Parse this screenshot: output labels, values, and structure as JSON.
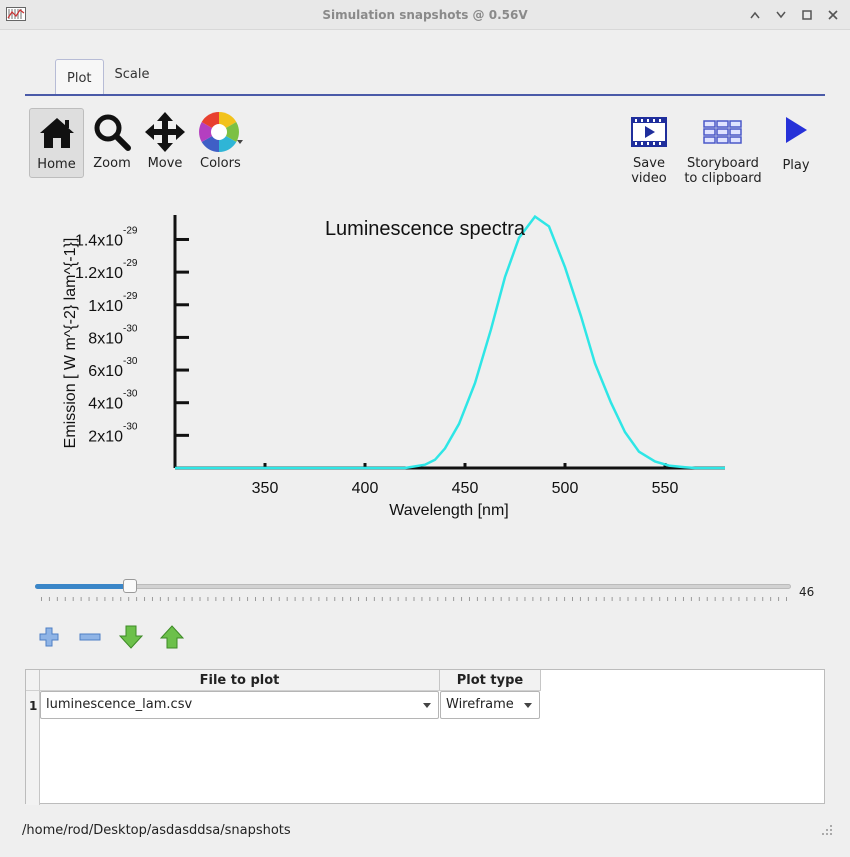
{
  "window": {
    "title": "Simulation snapshots @ 0.56V",
    "controls": [
      "minimize-icon",
      "maximize-icon",
      "close-icon"
    ]
  },
  "tabs": [
    {
      "label": "Plot",
      "active": true
    },
    {
      "label": "Scale",
      "active": false
    }
  ],
  "toolbar": {
    "home": "Home",
    "zoom": "Zoom",
    "move": "Move",
    "colors": "Colors",
    "save_video": [
      "Save",
      "video"
    ],
    "storyboard": [
      "Storyboard",
      "to clipboard"
    ],
    "play": "Play"
  },
  "chart_data": {
    "type": "line",
    "title": "Luminescence spectra",
    "xlabel": "Wavelength [nm]",
    "ylabel": "Emission [ W m^{-2} lam^{-1}]",
    "xlim": [
      305,
      580
    ],
    "ylim": [
      0,
      1.55e-29
    ],
    "x_ticks": [
      350,
      400,
      450,
      500,
      550
    ],
    "y_ticks": [
      {
        "value": 2e-30,
        "mantissa": "2x10",
        "exp": "-30"
      },
      {
        "value": 4e-30,
        "mantissa": "4x10",
        "exp": "-30"
      },
      {
        "value": 6e-30,
        "mantissa": "6x10",
        "exp": "-30"
      },
      {
        "value": 8e-30,
        "mantissa": "8x10",
        "exp": "-30"
      },
      {
        "value": 1e-29,
        "mantissa": "1x10",
        "exp": "-29"
      },
      {
        "value": 1.2e-29,
        "mantissa": "1.2x10",
        "exp": "-29"
      },
      {
        "value": 1.4e-29,
        "mantissa": "1.4x10",
        "exp": "-29"
      }
    ],
    "grid": false,
    "color": "#2ee6e6",
    "series": [
      {
        "x": [
          305,
          420,
          430,
          435,
          440,
          447,
          455,
          463,
          470,
          477,
          485,
          492,
          500,
          508,
          515,
          523,
          530,
          537,
          545,
          552,
          560,
          565,
          570,
          580
        ],
        "y": [
          0,
          0,
          2e-31,
          5e-31,
          1.2e-30,
          2.7e-30,
          5.2e-30,
          8.5e-30,
          1.17e-29,
          1.41e-29,
          1.54e-29,
          1.48e-29,
          1.23e-29,
          9.3e-30,
          6.4e-30,
          4e-30,
          2.2e-30,
          1e-30,
          4e-31,
          1.5e-31,
          5e-32,
          0,
          0,
          0
        ]
      }
    ]
  },
  "slider": {
    "value": 46,
    "max": 500,
    "fraction": 0.125
  },
  "table": {
    "headers": [
      "File to plot",
      "Plot type"
    ],
    "rows": [
      {
        "index": "1",
        "file": "luminescence_lam.csv",
        "plot_type": "Wireframe"
      }
    ]
  },
  "status": {
    "path": "/home/rod/Desktop/asdasddsa/snapshots"
  },
  "colors": {
    "accent": "#4a5aa8",
    "slider": "#3a86c8",
    "curve": "#2ee6e6"
  }
}
